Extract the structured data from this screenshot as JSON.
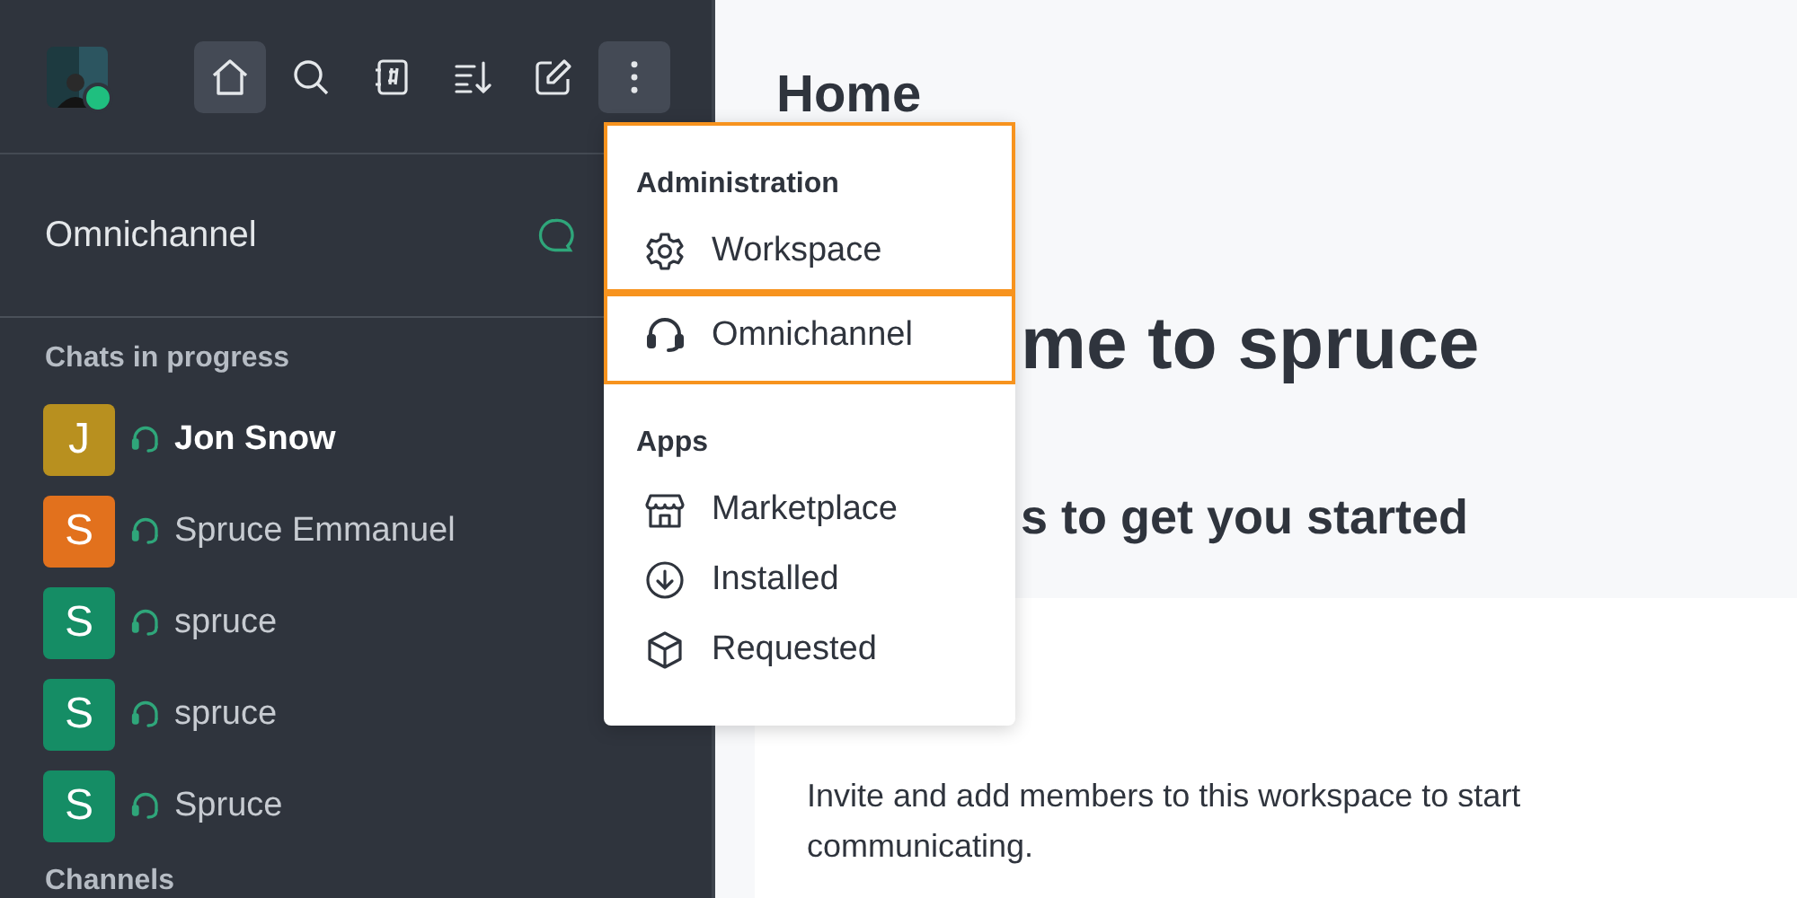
{
  "sidebar": {
    "toolbar": [
      {
        "selected": true
      },
      {
        "selected": false
      },
      {
        "selected": false
      },
      {
        "selected": false
      },
      {
        "selected": false
      },
      {
        "selected": true
      }
    ],
    "section_title": "Omnichannel",
    "group_title": "Chats in progress",
    "chats": [
      {
        "initial": "J",
        "name": "Jon Snow",
        "color": "#b8901f",
        "unread": true
      },
      {
        "initial": "S",
        "name": "Spruce Emmanuel",
        "color": "#e2711d",
        "unread": false
      },
      {
        "initial": "S",
        "name": "spruce",
        "color": "#158d65",
        "unread": false
      },
      {
        "initial": "S",
        "name": "spruce",
        "color": "#158d65",
        "unread": false
      },
      {
        "initial": "S",
        "name": "Spruce",
        "color": "#158d65",
        "unread": false
      }
    ],
    "next_group_title": "Channels"
  },
  "menu": {
    "groups": [
      {
        "heading": "Administration",
        "highlighted": true,
        "items": [
          {
            "label": "Workspace",
            "kind": "gear"
          }
        ]
      },
      {
        "highlighted": true,
        "items": [
          {
            "label": "Omnichannel",
            "kind": "headset"
          }
        ]
      },
      {
        "heading": "Apps",
        "highlighted": false,
        "items": [
          {
            "label": "Marketplace",
            "kind": "store"
          },
          {
            "label": "Installed",
            "kind": "download"
          },
          {
            "label": "Requested",
            "kind": "cube"
          }
        ]
      }
    ]
  },
  "main": {
    "title": "Home",
    "welcome_visible": "me to spruce",
    "subtitle_visible": "s to get you started",
    "card_text": "Invite and add members to this workspace to start communicating."
  }
}
